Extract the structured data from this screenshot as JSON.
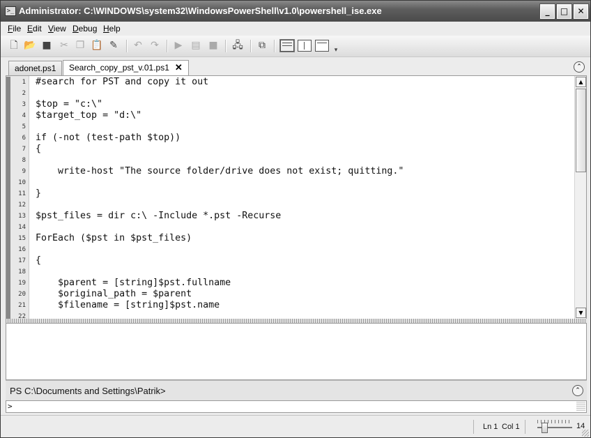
{
  "window": {
    "title": "Administrator: C:\\WINDOWS\\system32\\WindowsPowerShell\\v1.0\\powershell_ise.exe",
    "controls": {
      "minimize": "_",
      "maximize": "□",
      "close": "✕"
    }
  },
  "menu": [
    {
      "accel": "F",
      "rest": "ile"
    },
    {
      "accel": "E",
      "rest": "dit"
    },
    {
      "accel": "V",
      "rest": "iew"
    },
    {
      "accel": "D",
      "rest": "ebug"
    },
    {
      "accel": "H",
      "rest": "elp"
    }
  ],
  "toolbar": {
    "icons": [
      "new-file-icon",
      "open-file-icon",
      "save-icon",
      "cut-icon",
      "copy-icon",
      "paste-icon",
      "clear-icon",
      "undo-icon",
      "redo-icon",
      "run-icon",
      "run-selection-icon",
      "stop-icon",
      "new-remote-tab-icon",
      "powershell-icon",
      "layout-top-icon",
      "layout-right-icon",
      "layout-max-icon"
    ]
  },
  "tabs": [
    {
      "label": "adonet.ps1",
      "active": false
    },
    {
      "label": "Search_copy_pst_v.01.ps1",
      "active": true,
      "close": "✕"
    }
  ],
  "collapse_glyph": "⌃",
  "editor": {
    "lines": [
      {
        "n": "1",
        "text": "#search for PST and copy it out"
      },
      {
        "n": "2",
        "text": ""
      },
      {
        "n": "3",
        "text": "$top = \"c:\\\""
      },
      {
        "n": "4",
        "text": "$target_top = \"d:\\\""
      },
      {
        "n": "5",
        "text": ""
      },
      {
        "n": "6",
        "text": "if (-not (test-path $top))"
      },
      {
        "n": "7",
        "text": "{"
      },
      {
        "n": "8",
        "text": ""
      },
      {
        "n": "9",
        "text": "    write-host \"The source folder/drive does not exist; quitting.\""
      },
      {
        "n": "10",
        "text": ""
      },
      {
        "n": "11",
        "text": "}"
      },
      {
        "n": "12",
        "text": ""
      },
      {
        "n": "13",
        "text": "$pst_files = dir c:\\ -Include *.pst -Recurse"
      },
      {
        "n": "14",
        "text": ""
      },
      {
        "n": "15",
        "text": "ForEach ($pst in $pst_files)"
      },
      {
        "n": "16",
        "text": ""
      },
      {
        "n": "17",
        "text": "{"
      },
      {
        "n": "18",
        "text": ""
      },
      {
        "n": "19",
        "text": "    $parent = [string]$pst.fullname"
      },
      {
        "n": "20",
        "text": "    $original_path = $parent"
      },
      {
        "n": "21",
        "text": "    $filename = [string]$pst.name"
      },
      {
        "n": "22",
        "text": ""
      }
    ]
  },
  "console": {
    "prompt": "PS C:\\Documents and Settings\\Patrik>",
    "input_prompt": ">",
    "up_glyph": "⌃"
  },
  "status": {
    "line": "Ln 1",
    "col": "Col 1",
    "zoom": "14"
  }
}
